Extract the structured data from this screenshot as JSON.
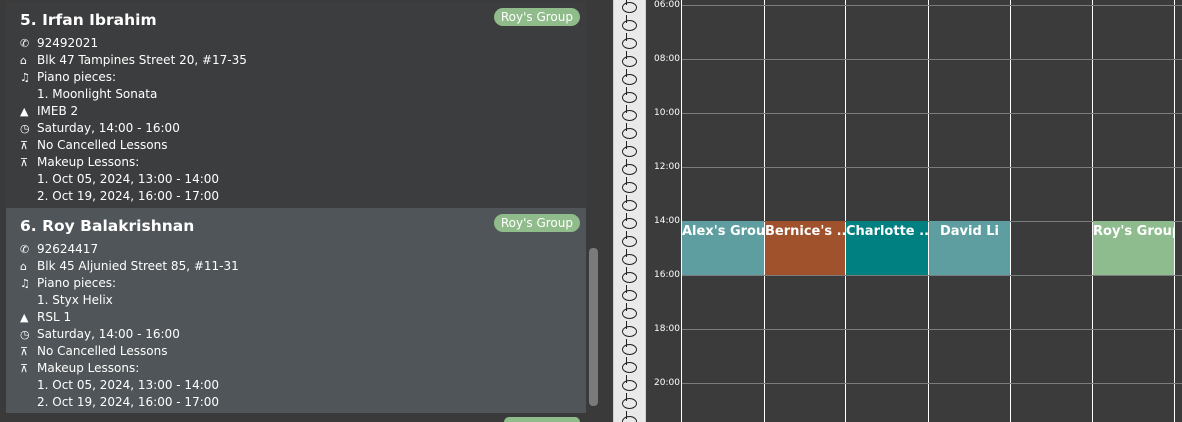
{
  "students": [
    {
      "number": "5.",
      "name": "Irfan Ibrahim",
      "group": "Roy's Group",
      "phone": "92492021",
      "address": "Blk 47 Tampines Street 20, #17-35",
      "pieces_label": "Piano pieces:",
      "pieces": [
        "1. Moonlight Sonata"
      ],
      "grade": "IMEB 2",
      "lesson_time": "Saturday, 14:00 - 16:00",
      "cancelled": "No Cancelled Lessons",
      "makeup_label": "Makeup Lessons:",
      "makeup": [
        "1. Oct 05, 2024, 13:00 - 14:00",
        "2. Oct 19, 2024, 16:00 - 17:00"
      ]
    },
    {
      "number": "6.",
      "name": "Roy Balakrishnan",
      "group": "Roy's Group",
      "phone": "92624417",
      "address": "Blk 45 Aljunied Street 85, #11-31",
      "pieces_label": "Piano pieces:",
      "pieces": [
        "1. Styx Helix"
      ],
      "grade": "RSL 1",
      "lesson_time": "Saturday, 14:00 - 16:00",
      "cancelled": "No Cancelled Lessons",
      "makeup_label": "Makeup Lessons:",
      "makeup": [
        "1. Oct 05, 2024, 13:00 - 14:00",
        "2. Oct 19, 2024, 16:00 - 17:00"
      ]
    }
  ],
  "calendar": {
    "time_labels": [
      "06:00",
      "08:00",
      "10:00",
      "12:00",
      "14:00",
      "16:00",
      "18:00",
      "20:00"
    ],
    "events": [
      {
        "label": "Alex's Group",
        "color": "#5f9ea0"
      },
      {
        "label": "Bernice's ...",
        "color": "#a0522d"
      },
      {
        "label": "Charlotte ...",
        "color": "#008080"
      },
      {
        "label": "David Li",
        "color": "#5f9ea0"
      },
      {
        "label": "",
        "color": ""
      },
      {
        "label": "Roy's Group",
        "color": "#8fbc8f"
      }
    ]
  },
  "icons": {
    "phone": "phone-icon",
    "address": "home-icon",
    "pieces": "music-note-icon",
    "grade": "graduation-cap-icon",
    "time": "clock-icon",
    "cancelled": "cancelled-lesson-icon",
    "makeup": "makeup-lesson-icon"
  }
}
